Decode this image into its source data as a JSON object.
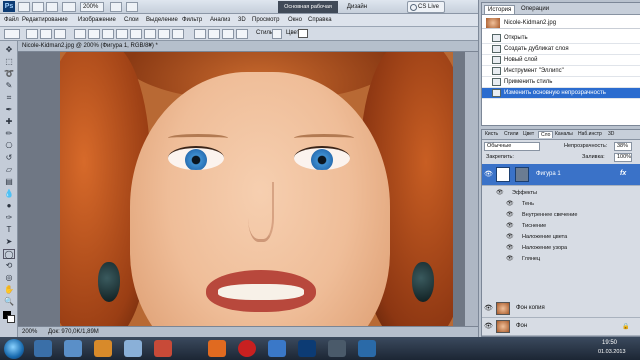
{
  "app": {
    "zoom_dropdown": "200%",
    "workspace_label": "Основная рабочая среда",
    "design_label": "Дизайн",
    "cslive_label": "CS Live",
    "menu": [
      "Файл",
      "Редактирование",
      "Изображение",
      "Слои",
      "Выделение",
      "Фильтр",
      "Анализ",
      "3D",
      "Просмотр",
      "Окно",
      "Справка"
    ]
  },
  "options_bar": {
    "style_label": "Стиль:",
    "color_label": "Цвет:"
  },
  "document": {
    "tab_label": "Nicole-Kidman2.jpg @ 200% (Фигура 1, RGB/8#) *",
    "zoom_status": "200%",
    "doc_status": "Док: 970,0K/1,89M"
  },
  "history": {
    "tabs": [
      "История",
      "Операции"
    ],
    "snapshot": "Nicole-Kidman2.jpg",
    "rows": [
      "Открыть",
      "Создать дубликат слоя",
      "Новый слой",
      "Инструмент \"Эллипс\"",
      "Применить стиль",
      "Изменить основную непрозрачность"
    ],
    "selected_index": 5
  },
  "layers": {
    "tabs": [
      "Кисть",
      "Стили",
      "Цвет",
      "Сло",
      "Каналы",
      "Наб.инстр",
      "3D"
    ],
    "blend_mode": "Обычные",
    "opacity_label": "Непрозрачность:",
    "opacity_value": "38%",
    "lock_label": "Закрепить:",
    "fill_label": "Заливка:",
    "fill_value": "100%",
    "shape_layer_name": "Фигура 1",
    "fx_badge": "fx",
    "effects_header": "Эффекты",
    "effects": [
      "Тень",
      "Внутреннее свечение",
      "Тиснение",
      "Наложение цвета",
      "Наложение узора",
      "Глянец"
    ],
    "copy_layer_name": "Фон копия",
    "bg_layer_name": "Фон"
  },
  "taskbar": {
    "time": "19:50",
    "date": "01.03.2013"
  }
}
